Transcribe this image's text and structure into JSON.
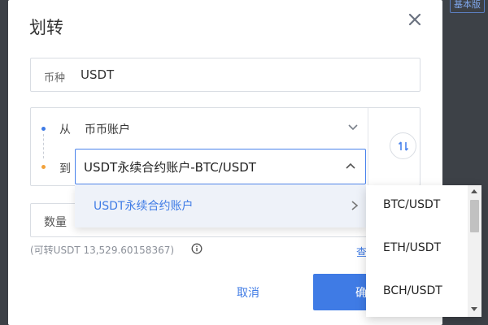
{
  "corner_badge": "基本版",
  "modal": {
    "title": "划转",
    "coin": {
      "label": "币种",
      "value": "USDT"
    },
    "from": {
      "label": "从",
      "value": "币币账户"
    },
    "to": {
      "label": "到",
      "value": "USDT永续合约账户-BTC/USDT"
    },
    "amount": {
      "label": "数量"
    },
    "available": "(可转USDT 13,529.60158367)",
    "partial_link": "查",
    "cancel_label": "取消",
    "confirm_label": "确"
  },
  "dropdown": {
    "level1": [
      {
        "label": "USDT永续合约账户"
      }
    ],
    "level2": [
      {
        "label": "BTC/USDT"
      },
      {
        "label": "ETH/USDT"
      },
      {
        "label": "BCH/USDT"
      }
    ]
  },
  "colors": {
    "accent": "#3f7be5",
    "from_dot": "#3f7be5",
    "to_dot": "#f2a23b",
    "overlay": "#3d4147"
  },
  "icons": [
    "close-icon",
    "chevron-down-icon",
    "chevron-up-icon",
    "swap-icon",
    "info-icon",
    "chevron-right-icon"
  ]
}
